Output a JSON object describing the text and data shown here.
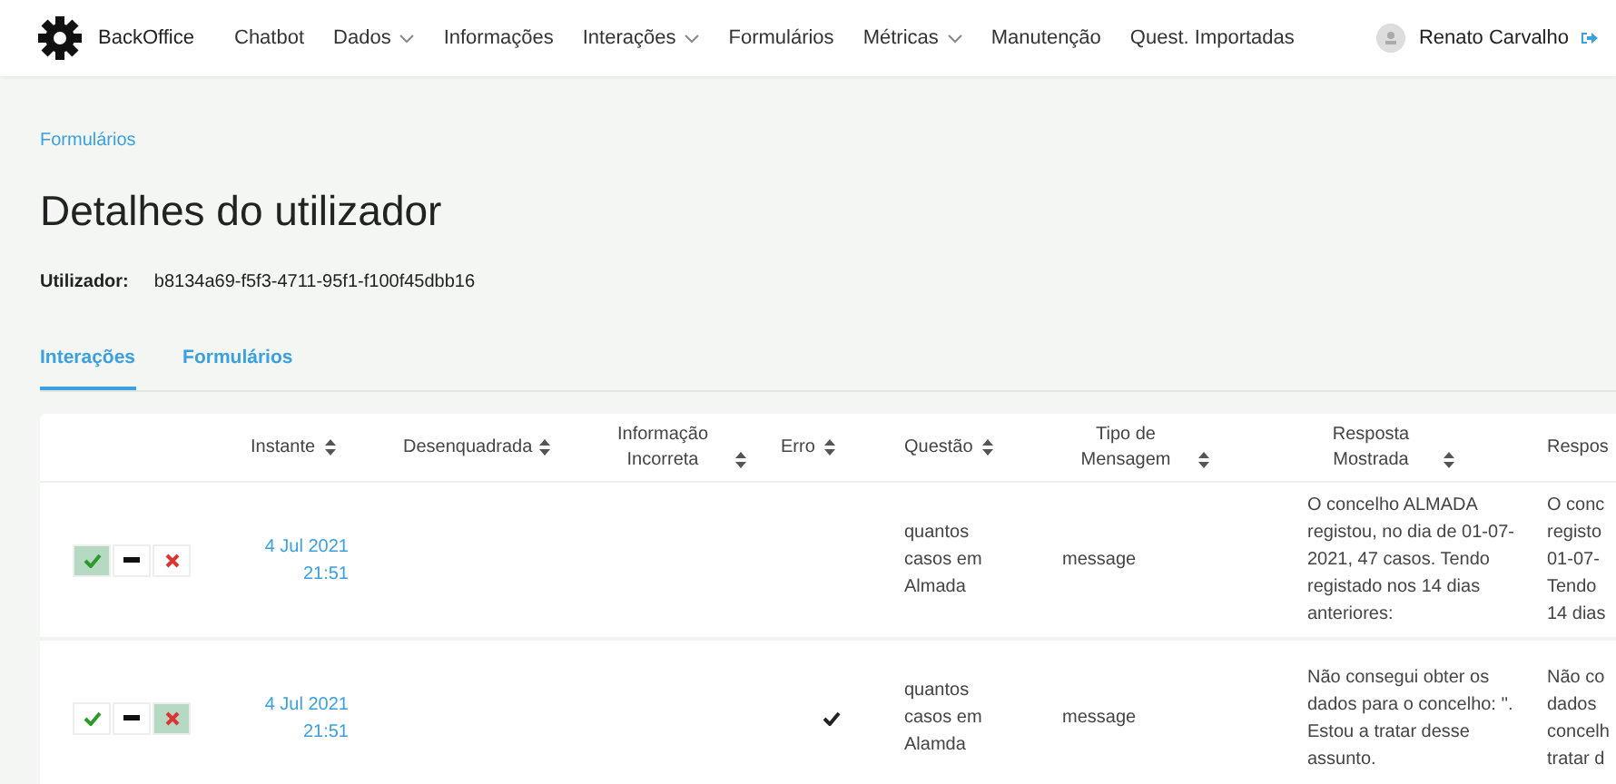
{
  "navbar": {
    "brand": "BackOffice",
    "items": [
      {
        "label": "Chatbot",
        "dropdown": false
      },
      {
        "label": "Dados",
        "dropdown": true
      },
      {
        "label": "Informações",
        "dropdown": false
      },
      {
        "label": "Interações",
        "dropdown": true
      },
      {
        "label": "Formulários",
        "dropdown": false
      },
      {
        "label": "Métricas",
        "dropdown": true
      },
      {
        "label": "Manutenção",
        "dropdown": false
      },
      {
        "label": "Quest. Importadas",
        "dropdown": false
      }
    ],
    "user": "Renato Carvalho"
  },
  "breadcrumb": "Formulários",
  "title": "Detalhes do utilizador",
  "user_field": {
    "label": "Utilizador:",
    "value": "b8134a69-f5f3-4711-95f1-f100f45dbb16"
  },
  "tabs": [
    {
      "label": "Interações",
      "selected": true
    },
    {
      "label": "Formulários",
      "selected": false
    }
  ],
  "table": {
    "columns": [
      {
        "label": "Instante",
        "sortable": true
      },
      {
        "label": "Desenquadrada",
        "sortable": true
      },
      {
        "label": "Informação Incorreta",
        "sortable": true
      },
      {
        "label": "Erro",
        "sortable": true
      },
      {
        "label": "Questão",
        "sortable": true
      },
      {
        "label": "Tipo de Mensagem",
        "sortable": true
      },
      {
        "label": "Resposta Mostrada",
        "sortable": true
      },
      {
        "label": "Respos"
      }
    ],
    "rows": [
      {
        "actions": [
          {
            "kind": "accept",
            "selected": true
          },
          {
            "kind": "neutral",
            "selected": false
          },
          {
            "kind": "reject",
            "selected": false
          }
        ],
        "date": "4 Jul 2021",
        "time": "21:51",
        "desenquadrada": false,
        "informacao_incorreta": false,
        "erro": false,
        "questao": "quantos casos em Almada",
        "tipo": "message",
        "resposta": "O concelho ALMADA registou, no dia  de 01-07-2021, 47 casos. Tendo registado nos 14 dias anteriores:",
        "column_8": [
          "O conc",
          "registo",
          "01-07-",
          "Tendo",
          "14 dias"
        ]
      },
      {
        "actions": [
          {
            "kind": "accept",
            "selected": false
          },
          {
            "kind": "neutral",
            "selected": false
          },
          {
            "kind": "reject",
            "selected": true
          }
        ],
        "date": "4 Jul 2021",
        "time": "21:51",
        "desenquadrada": false,
        "informacao_incorreta": false,
        "erro": true,
        "questao": "quantos casos em Alamda",
        "tipo": "message",
        "resposta": "Não consegui obter os dados para o concelho: ''. Estou a tratar desse assunto.",
        "column_8": [
          "Não co",
          "dados",
          "concelh",
          "tratar d"
        ]
      }
    ]
  }
}
